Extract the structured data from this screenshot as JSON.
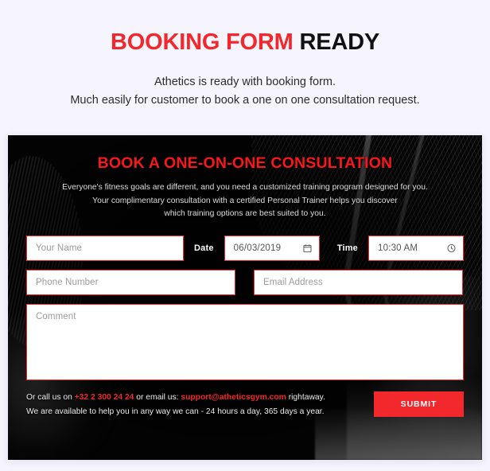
{
  "page": {
    "background_color": "#f6f5fe",
    "accent_color": "#f2282c"
  },
  "heading": {
    "title_accent": "BOOKING FORM",
    "title_rest": "READY",
    "subtitle_line1": "Athetics is ready with booking form.",
    "subtitle_line2": "Much easily for customer to book a one on one consultation request."
  },
  "panel": {
    "title": "BOOK A ONE-ON-ONE CONSULTATION",
    "desc_line1": "Everyone's fitness goals are different, and you need a customized training program designed for you.",
    "desc_line2": "Your complimentary consultation with a certified Personal Trainer helps you discover",
    "desc_line3": "which training options are best suited to you."
  },
  "form": {
    "name_placeholder": "Your Name",
    "date_label": "Date",
    "date_value": "06/03/2019",
    "date_icon": "calendar-icon",
    "time_label": "Time",
    "time_value": "10:30 AM",
    "time_icon": "clock-icon",
    "phone_placeholder": "Phone Number",
    "email_placeholder": "Email Address",
    "comment_placeholder": "Comment",
    "submit_label": "SUBMIT"
  },
  "footer": {
    "line1_prefix": "Or call us on ",
    "phone": "+32 2 300 24 24",
    "line1_middle": " or email us: ",
    "email": "support@atheticsgym.com",
    "line1_suffix": " rightaway.",
    "line2": "We are available to help you in any way we can - 24 hours a day, 365 days a year."
  }
}
